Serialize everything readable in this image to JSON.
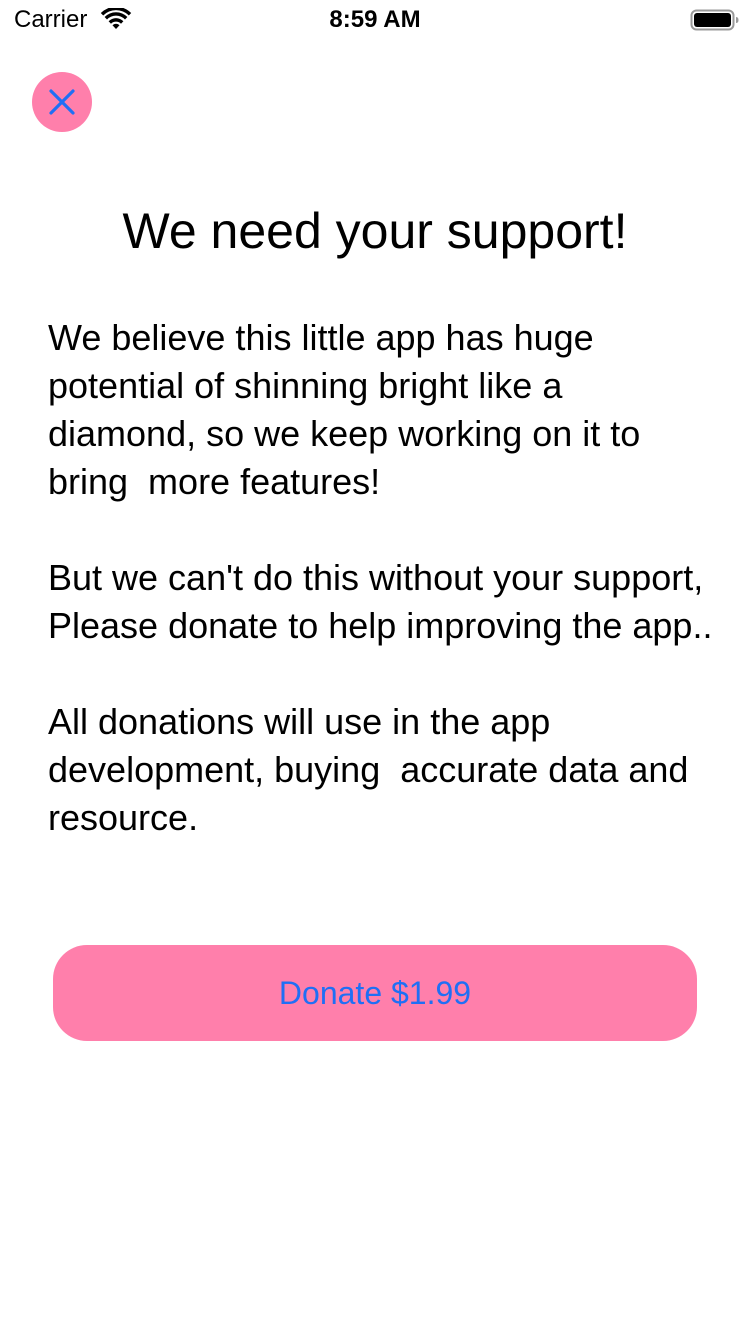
{
  "status_bar": {
    "carrier": "Carrier",
    "time": "8:59 AM",
    "wifi_icon": "wifi-icon",
    "battery_icon": "battery-full-icon"
  },
  "close_button": {
    "icon": "close-icon"
  },
  "title": "We need your support!",
  "paragraphs": [
    "We believe this little app has huge potential of shinning bright like a diamond, so we keep working on it to bring  more features!",
    "But we can't do this without your support, Please donate to help improving the app..",
    "All donations will use in the app development, buying  accurate data and resource."
  ],
  "donate_button": {
    "label": "Donate $1.99"
  },
  "colors": {
    "accent_pink": "#FF7FAB",
    "link_blue": "#1F6FF5",
    "text": "#000000",
    "background": "#FFFFFF"
  }
}
